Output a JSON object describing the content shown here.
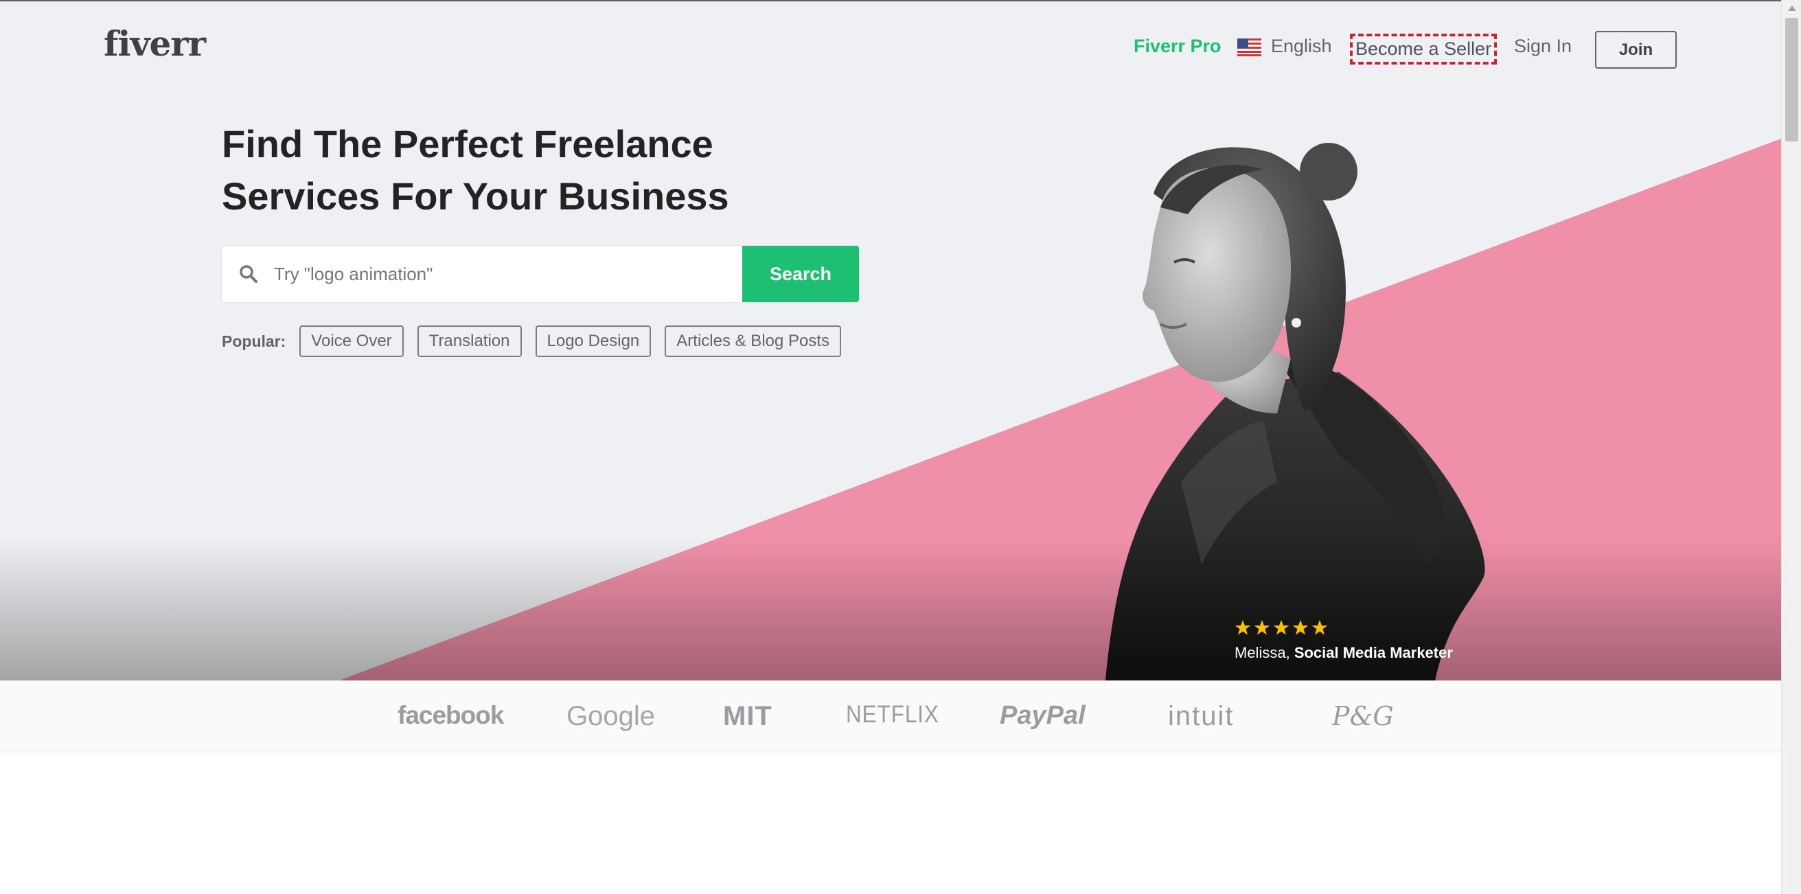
{
  "header": {
    "logo": "fiverr",
    "nav": {
      "pro": "Fiverr Pro",
      "language": "English",
      "become_seller": "Become a Seller",
      "sign_in": "Sign In",
      "join": "Join"
    },
    "flag_icon": "us-flag-icon"
  },
  "hero": {
    "headline_line1": "Find The Perfect Freelance",
    "headline_line2": "Services For Your Business",
    "search": {
      "placeholder": "Try \"logo animation\"",
      "button_label": "Search",
      "icon": "search-icon"
    },
    "popular": {
      "label": "Popular:",
      "tags": [
        "Voice Over",
        "Translation",
        "Logo Design",
        "Articles & Blog Posts"
      ]
    },
    "testimonial": {
      "rating_stars": 5,
      "name": "Melissa,",
      "role": "Social Media Marketer"
    }
  },
  "trusted_by": {
    "brands": [
      "facebook",
      "Google",
      "MIT",
      "NETFLIX",
      "PayPal",
      "intuit",
      "P&G"
    ]
  },
  "colors": {
    "brand_green": "#1dbf73",
    "hero_bg": "#eef0f3",
    "pink_triangle": "#f08fa8",
    "star_yellow": "#ffbe00",
    "highlight_dashed": "#c7252f"
  }
}
